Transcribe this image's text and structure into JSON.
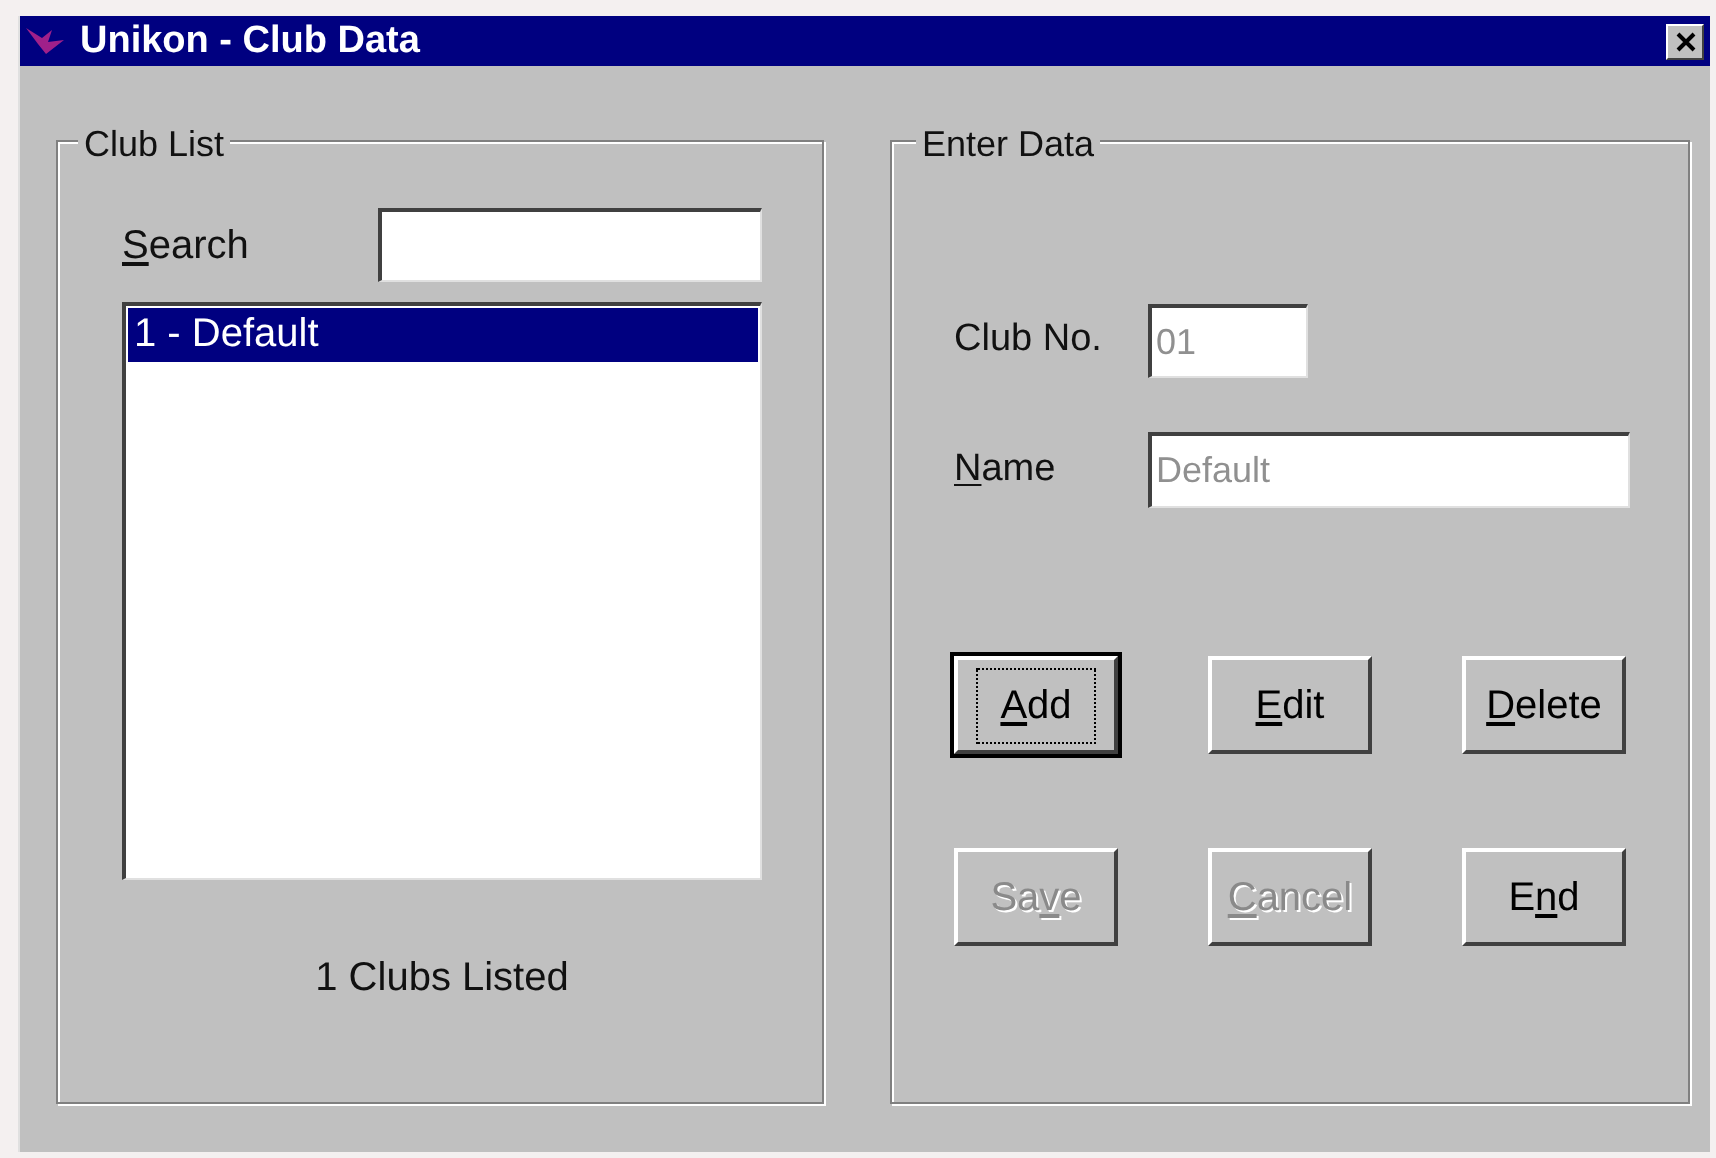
{
  "window": {
    "title": "Unikon - Club Data"
  },
  "club_list": {
    "legend": "Club List",
    "search": {
      "label": {
        "key": "S",
        "post": "earch"
      }
    },
    "items": [
      {
        "text": "1 - Default",
        "selected": true
      }
    ],
    "count": "1 Clubs Listed"
  },
  "enter_data": {
    "legend": "Enter Data",
    "fields": [
      {
        "label": {
          "pre": "Club No."
        },
        "value": "01",
        "disabled": true
      },
      {
        "label": {
          "key": "N",
          "post": "ame"
        },
        "value": "Default",
        "disabled": true
      }
    ],
    "buttons": [
      {
        "label": {
          "key": "A",
          "post": "dd"
        },
        "disabled": false,
        "default": true
      },
      {
        "label": {
          "key": "E",
          "post": "dit"
        },
        "disabled": false,
        "default": false
      },
      {
        "label": {
          "key": "D",
          "post": "elete"
        },
        "disabled": false,
        "default": false
      },
      {
        "label": {
          "pre": "Sa",
          "key": "v",
          "post": "e"
        },
        "disabled": true,
        "default": false
      },
      {
        "label": {
          "key": "C",
          "post": "ancel"
        },
        "disabled": true,
        "default": false
      },
      {
        "label": {
          "pre": "E",
          "key": "n",
          "post": "d"
        },
        "disabled": false,
        "default": false
      }
    ]
  }
}
